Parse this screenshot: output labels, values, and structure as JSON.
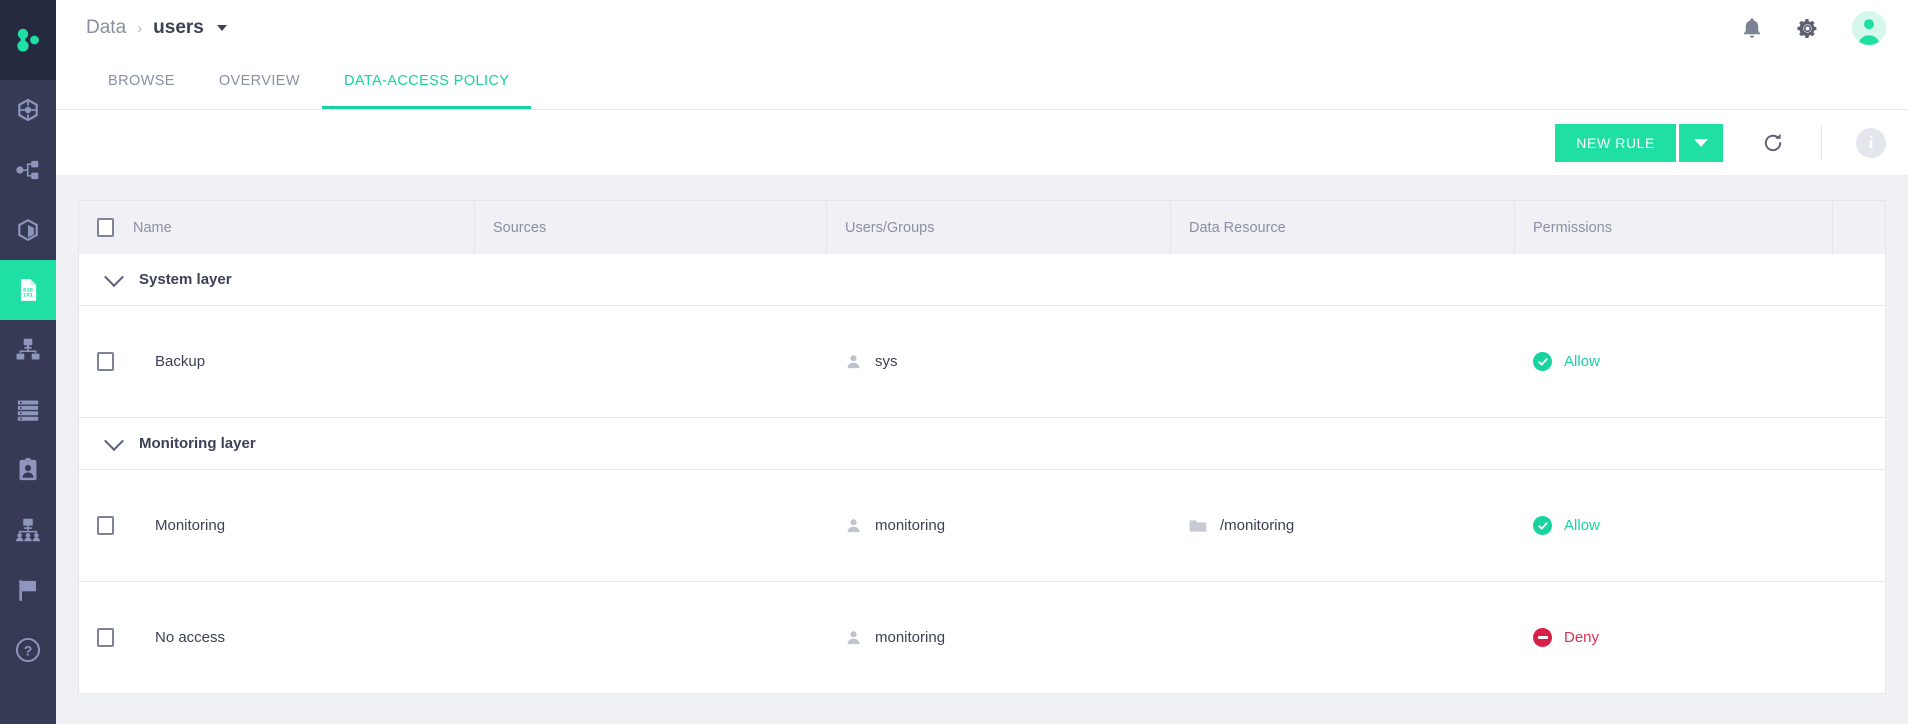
{
  "brand": {
    "logo_name": "molecule-logo",
    "accent": "#1fdfa3",
    "sidebar_bg": "#363a54"
  },
  "header": {
    "breadcrumb_root": "Data",
    "breadcrumb_separator": "›",
    "breadcrumb_current": "users",
    "actions": [
      {
        "name": "notifications-icon",
        "label": "Notifications"
      },
      {
        "name": "gear-icon",
        "label": "Settings"
      },
      {
        "name": "avatar",
        "label": "Account"
      }
    ]
  },
  "sidebar": {
    "items": [
      {
        "name": "sidebar-item-cube-network",
        "icon": "cube-network-icon",
        "active": false
      },
      {
        "name": "sidebar-item-hierarchy",
        "icon": "hierarchy-icon",
        "active": false
      },
      {
        "name": "sidebar-item-package",
        "icon": "package-icon",
        "active": false
      },
      {
        "name": "sidebar-item-data",
        "icon": "binary-file-icon",
        "active": true
      },
      {
        "name": "sidebar-item-cluster",
        "icon": "cluster-icon",
        "active": false
      },
      {
        "name": "sidebar-item-servers",
        "icon": "server-list-icon",
        "active": false
      },
      {
        "name": "sidebar-item-identity",
        "icon": "id-badge-icon",
        "active": false
      },
      {
        "name": "sidebar-item-teams",
        "icon": "team-icon",
        "active": false
      },
      {
        "name": "sidebar-item-flags",
        "icon": "flag-icon",
        "active": false
      },
      {
        "name": "sidebar-item-help",
        "icon": "help-icon",
        "active": false
      }
    ]
  },
  "tabs": [
    {
      "label": "BROWSE",
      "active": false
    },
    {
      "label": "OVERVIEW",
      "active": false
    },
    {
      "label": "DATA-ACCESS POLICY",
      "active": true
    }
  ],
  "toolbar": {
    "new_rule_label": "NEW RULE",
    "dropdown_name": "new-rule-dropdown",
    "refresh_name": "refresh-icon",
    "info_label": "i"
  },
  "table": {
    "columns": [
      "Name",
      "Sources",
      "Users/Groups",
      "Data Resource",
      "Permissions"
    ],
    "select_all_checked": false,
    "groups": [
      {
        "label": "System layer",
        "expanded": true,
        "rows": [
          {
            "checked": false,
            "name": "Backup",
            "sources": "",
            "users_groups": "sys",
            "data_resource": "",
            "permission": "Allow",
            "permission_type": "allow"
          }
        ]
      },
      {
        "label": "Monitoring layer",
        "expanded": true,
        "rows": [
          {
            "checked": false,
            "name": "Monitoring",
            "sources": "",
            "users_groups": "monitoring",
            "data_resource": "/monitoring",
            "permission": "Allow",
            "permission_type": "allow"
          },
          {
            "checked": false,
            "name": "No access",
            "sources": "",
            "users_groups": "monitoring",
            "data_resource": "",
            "permission": "Deny",
            "permission_type": "deny"
          }
        ]
      }
    ]
  }
}
